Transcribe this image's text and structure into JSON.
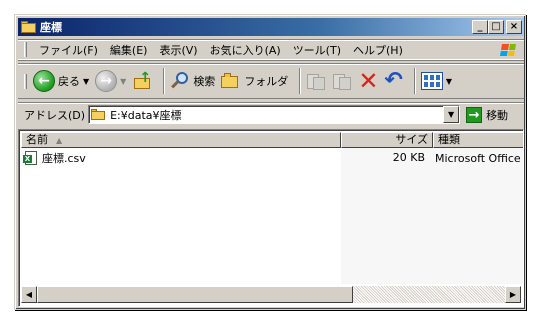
{
  "window": {
    "title": "座標"
  },
  "menu": [
    {
      "label": "ファイル(F)"
    },
    {
      "label": "編集(E)"
    },
    {
      "label": "表示(V)"
    },
    {
      "label": "お気に入り(A)"
    },
    {
      "label": "ツール(T)"
    },
    {
      "label": "ヘルプ(H)"
    }
  ],
  "toolbar": {
    "back_label": "戻る",
    "search_label": "検索",
    "folders_label": "フォルダ"
  },
  "address": {
    "label": "アドレス(D)",
    "value": "E:¥data¥座標",
    "go_label": "移動"
  },
  "list": {
    "columns": [
      {
        "label": "名前"
      },
      {
        "label": "サイズ"
      },
      {
        "label": "種類"
      }
    ],
    "rows": [
      {
        "name": "座標.csv",
        "size": "20 KB",
        "type": "Microsoft Office Excel CSV ファイル"
      }
    ]
  },
  "colors": {
    "title_start": "#0a246a",
    "title_end": "#a6caf0",
    "face": "#d4d0c8"
  }
}
